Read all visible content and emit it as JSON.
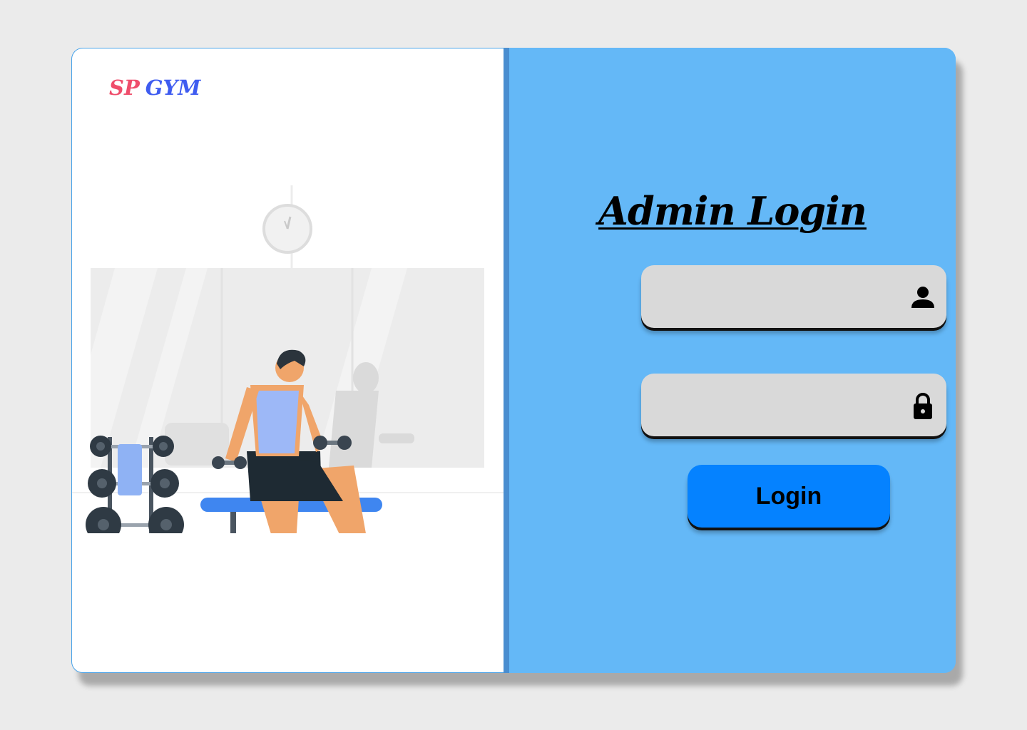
{
  "brand": {
    "part1": "SP",
    "part2": "GYM",
    "color1": "#ef4d6b",
    "color2": "#3f5cf0"
  },
  "illustration": {
    "description_icon": "gym-man-dumbbell-illustration"
  },
  "login": {
    "title": "Admin Login",
    "username": {
      "value": "",
      "placeholder": "",
      "icon": "user-icon"
    },
    "password": {
      "value": "",
      "placeholder": "",
      "icon": "lock-icon"
    },
    "button_label": "Login"
  },
  "colors": {
    "page_bg": "#ebebeb",
    "panel_blue": "#64b8f7",
    "divider": "#4a8ed0",
    "field_bg": "#d9d9d9",
    "button_bg": "#0582ff"
  }
}
